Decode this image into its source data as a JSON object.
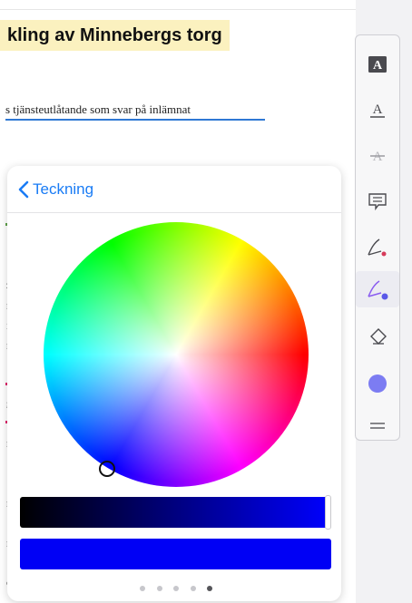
{
  "document": {
    "heading": "kling av Minnebergs torg",
    "line": "s tjänsteutlåtande som svar på inlämnat",
    "margin_marks": [
      {
        "text": "z",
        "kind": "text"
      },
      {
        "text": "r",
        "kind": "text"
      },
      {
        "text": "i",
        "kind": "text"
      },
      {
        "text": "r",
        "kind": "text"
      },
      {
        "text": "g",
        "kind": "text"
      },
      {
        "text": "r",
        "kind": "text"
      },
      {
        "text": "r",
        "kind": "text"
      },
      {
        "text": "r",
        "kind": "text"
      },
      {
        "text": "c",
        "kind": "text"
      }
    ],
    "heading_highlight_color": "#fbf1bf",
    "underline_color": "#2f78d4"
  },
  "toolbar": {
    "tools": [
      {
        "name": "text-box-icon",
        "label": "A"
      },
      {
        "name": "underline-icon",
        "label": "A"
      },
      {
        "name": "strikethrough-icon",
        "label": "A"
      },
      {
        "name": "comment-icon"
      },
      {
        "name": "pen-icon"
      },
      {
        "name": "drawing-pen-icon",
        "active": true
      },
      {
        "name": "eraser-icon"
      },
      {
        "name": "color-circle-icon"
      },
      {
        "name": "menu-lines-icon"
      }
    ],
    "accent_color": "#8a5cf0",
    "selected_color": "#7c7cf2"
  },
  "popover": {
    "back_label": "Teckning",
    "page_count": 5,
    "active_page": 5,
    "selected_color": "#0000f5"
  }
}
